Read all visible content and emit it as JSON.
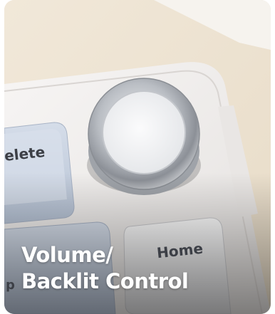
{
  "caption": {
    "line1": "Volume/",
    "line2": "Backlit Control"
  },
  "keys": {
    "delete_fragment": "elete",
    "home": "Home",
    "bottom_left_fragment": "p"
  },
  "colors": {
    "desk": "#efe6d6",
    "keyboard_case": "#f4f2f1",
    "keycap_blue": "#c9d3e2",
    "keycap_white": "#f7f7f8",
    "knob_metal": "#c8cbd0",
    "caption_text": "#ffffff"
  }
}
